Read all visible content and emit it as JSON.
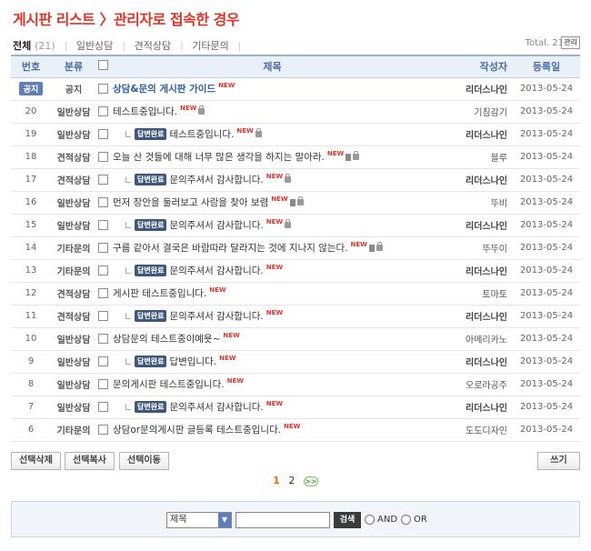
{
  "page_title": "게시판 리스트 〉관리자로 접속한 경우",
  "tabs": [
    {
      "label": "전체",
      "count": "(21)",
      "active": true
    },
    {
      "label": "일반상담"
    },
    {
      "label": "견적상담"
    },
    {
      "label": "기타문의"
    }
  ],
  "total_label": "Total. 21",
  "admin_label": "관리",
  "columns": {
    "no": "번호",
    "category": "분류",
    "subject": "제목",
    "author": "작성자",
    "date": "등록일"
  },
  "rows": [
    {
      "no": "공지",
      "notice": true,
      "category": "공지",
      "subject": "상담&문의 게시판 가이드",
      "reply": false,
      "is_new": true,
      "lock": false,
      "file": false,
      "author": "리더스나인",
      "admin": true,
      "date": "2013-05-24"
    },
    {
      "no": "20",
      "category": "일반상담",
      "subject": "테스트중입니다.",
      "reply": false,
      "is_new": true,
      "lock": true,
      "file": false,
      "author": "기침감기",
      "admin": false,
      "date": "2013-05-24"
    },
    {
      "no": "19",
      "category": "일반상담",
      "subject": "테스트중입니다.",
      "reply": true,
      "is_new": true,
      "lock": true,
      "file": false,
      "author": "리더스나인",
      "admin": true,
      "date": "2013-05-24"
    },
    {
      "no": "18",
      "category": "견적상담",
      "subject": "오늘 산 것들에 대해 너무 많은 생각을 하지는 말아라.",
      "reply": false,
      "is_new": true,
      "lock": true,
      "file": true,
      "author": "블루",
      "admin": false,
      "date": "2013-05-24"
    },
    {
      "no": "17",
      "category": "견적상담",
      "subject": "문의주셔서 감사합니다.",
      "reply": true,
      "is_new": true,
      "lock": true,
      "file": false,
      "author": "리더스나인",
      "admin": true,
      "date": "2013-05-24"
    },
    {
      "no": "16",
      "category": "일반상담",
      "subject": "먼저 장안을 둘러보고 사람을 찾아 보렴",
      "reply": false,
      "is_new": true,
      "lock": true,
      "file": true,
      "author": "뚜비",
      "admin": false,
      "date": "2013-05-24"
    },
    {
      "no": "15",
      "category": "일반상담",
      "subject": "문의주셔서 감사합니다.",
      "reply": true,
      "is_new": true,
      "lock": true,
      "file": false,
      "author": "리더스나인",
      "admin": true,
      "date": "2013-05-24"
    },
    {
      "no": "14",
      "category": "기타문의",
      "subject": "구름 같아서 결국은 바람따라 달라지는 것에 지나지 않는다.",
      "reply": false,
      "is_new": true,
      "lock": true,
      "file": true,
      "author": "뚜뚜이",
      "admin": false,
      "date": "2013-05-24"
    },
    {
      "no": "13",
      "category": "기타문의",
      "subject": "문의주셔서 감사합니다.",
      "reply": true,
      "is_new": true,
      "lock": false,
      "file": false,
      "author": "리더스나인",
      "admin": true,
      "date": "2013-05-24"
    },
    {
      "no": "12",
      "category": "견적상담",
      "subject": "게시판 테스트중입니다.",
      "reply": false,
      "is_new": true,
      "lock": false,
      "file": false,
      "author": "토마토",
      "admin": false,
      "date": "2013-05-24"
    },
    {
      "no": "11",
      "category": "견적상담",
      "subject": "문의주셔서 감사합니다.",
      "reply": true,
      "is_new": true,
      "lock": false,
      "file": false,
      "author": "리더스나인",
      "admin": true,
      "date": "2013-05-24"
    },
    {
      "no": "10",
      "category": "일반상담",
      "subject": "상담문의 테스트중이예욧~",
      "reply": false,
      "is_new": true,
      "lock": false,
      "file": false,
      "author": "아메리카노",
      "admin": false,
      "date": "2013-05-24"
    },
    {
      "no": "9",
      "category": "일반상담",
      "subject": "답변입니다.",
      "reply": true,
      "is_new": true,
      "lock": false,
      "file": false,
      "author": "리더스나인",
      "admin": true,
      "date": "2013-05-24"
    },
    {
      "no": "8",
      "category": "일반상담",
      "subject": "문의게시판 테스트중입니다.",
      "reply": false,
      "is_new": true,
      "lock": false,
      "file": false,
      "author": "오로라공주",
      "admin": false,
      "date": "2013-05-24"
    },
    {
      "no": "7",
      "category": "일반상담",
      "subject": "문의주셔서 감사합니다.",
      "reply": true,
      "is_new": true,
      "lock": false,
      "file": false,
      "author": "리더스나인",
      "admin": true,
      "date": "2013-05-24"
    },
    {
      "no": "6",
      "category": "기타문의",
      "subject": "상담or문의게시판 글등록 테스트중입니다.",
      "reply": false,
      "is_new": true,
      "lock": false,
      "file": false,
      "author": "도도디자인",
      "admin": false,
      "date": "2013-05-24"
    }
  ],
  "reply_badge": "답변완료",
  "new_label": "NEW",
  "buttons": {
    "delete": "선택삭제",
    "copy": "선택복사",
    "move": "선택이동",
    "write": "쓰기"
  },
  "pagination": {
    "current": "1",
    "pages": [
      "2"
    ],
    "next": ">>"
  },
  "search": {
    "field": "제목",
    "button": "검색",
    "and_label": "AND",
    "or_label": "OR",
    "value": ""
  },
  "colors": {
    "title": "#e0342a",
    "header_bg": "#e9f0f8",
    "notice": "#5f7fb6",
    "reply_badge": "#3f5779",
    "new": "#e0342a"
  }
}
